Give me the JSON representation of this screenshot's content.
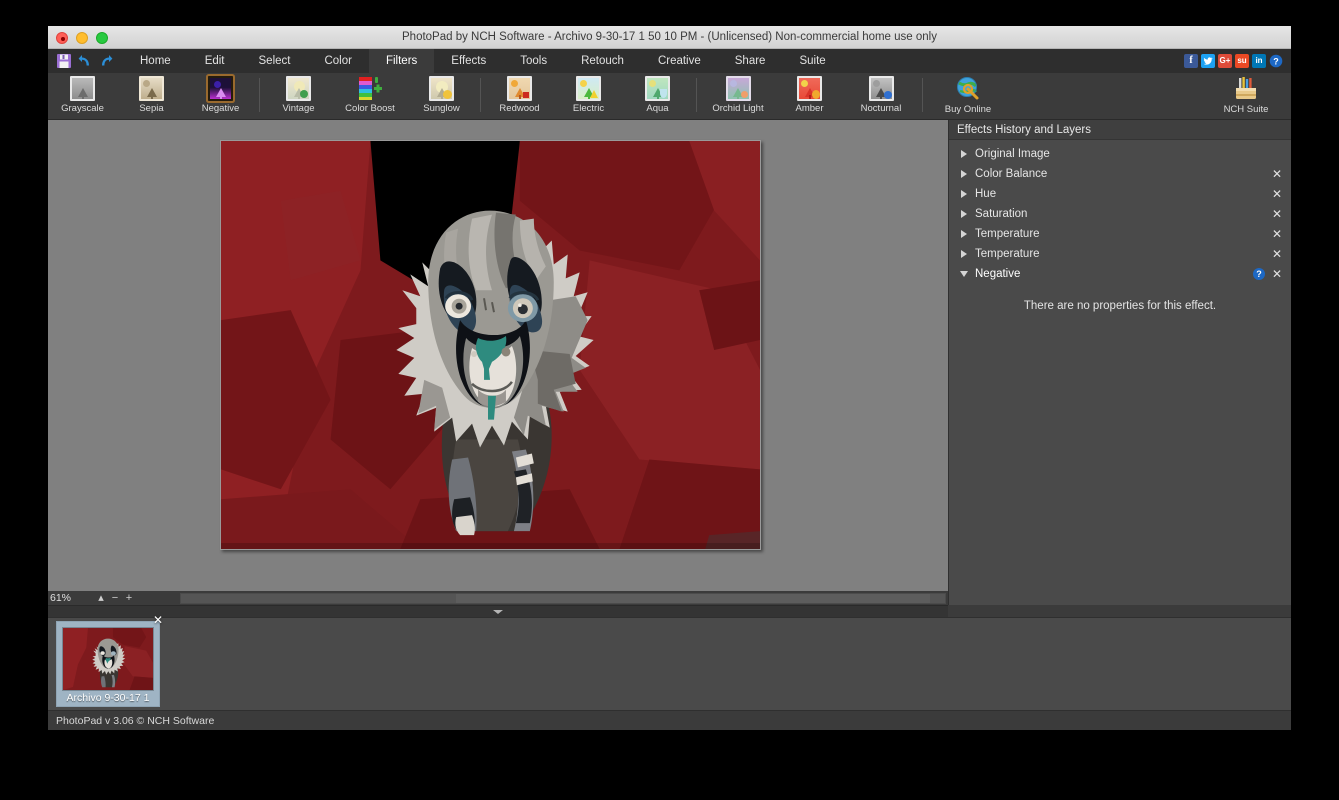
{
  "window": {
    "title": "PhotoPad by NCH Software - Archivo 9-30-17 1 50 10 PM - (Unlicensed) Non-commercial home use only",
    "controls": {
      "close": "close-button",
      "minimize": "minimize-button",
      "maximize": "maximize-button"
    }
  },
  "quick_actions": [
    {
      "name": "save-icon",
      "label": "Save"
    },
    {
      "name": "undo-icon",
      "label": "Undo"
    },
    {
      "name": "redo-icon",
      "label": "Redo"
    }
  ],
  "menu": {
    "tabs": [
      {
        "label": "Home",
        "active": false
      },
      {
        "label": "Edit",
        "active": false
      },
      {
        "label": "Select",
        "active": false
      },
      {
        "label": "Color",
        "active": false
      },
      {
        "label": "Filters",
        "active": true
      },
      {
        "label": "Effects",
        "active": false
      },
      {
        "label": "Tools",
        "active": false
      },
      {
        "label": "Retouch",
        "active": false
      },
      {
        "label": "Creative",
        "active": false
      },
      {
        "label": "Share",
        "active": false
      },
      {
        "label": "Suite",
        "active": false
      }
    ],
    "social": [
      {
        "name": "facebook-icon",
        "glyph": "f"
      },
      {
        "name": "twitter-icon",
        "glyph": "t"
      },
      {
        "name": "googleplus-icon",
        "glyph": "G+"
      },
      {
        "name": "stumbleupon-icon",
        "glyph": "su"
      },
      {
        "name": "linkedin-icon",
        "glyph": "in"
      },
      {
        "name": "help-icon",
        "glyph": "?"
      }
    ]
  },
  "ribbon": {
    "items": [
      {
        "label": "Grayscale",
        "icon": "grayscale-filter-icon",
        "selected": false
      },
      {
        "label": "Sepia",
        "icon": "sepia-filter-icon",
        "selected": false
      },
      {
        "label": "Negative",
        "icon": "negative-filter-icon",
        "selected": true
      },
      {
        "label": "Vintage",
        "icon": "vintage-filter-icon",
        "selected": false
      },
      {
        "label": "Color Boost",
        "icon": "color-boost-filter-icon",
        "selected": false
      },
      {
        "label": "Sunglow",
        "icon": "sunglow-filter-icon",
        "selected": false
      },
      {
        "label": "Redwood",
        "icon": "redwood-filter-icon",
        "selected": false
      },
      {
        "label": "Electric",
        "icon": "electric-filter-icon",
        "selected": false
      },
      {
        "label": "Aqua",
        "icon": "aqua-filter-icon",
        "selected": false
      },
      {
        "label": "Orchid Light",
        "icon": "orchid-light-filter-icon",
        "selected": false
      },
      {
        "label": "Amber",
        "icon": "amber-filter-icon",
        "selected": false
      },
      {
        "label": "Nocturnal",
        "icon": "nocturnal-filter-icon",
        "selected": false
      },
      {
        "label": "Buy Online",
        "icon": "buy-online-icon",
        "selected": false
      }
    ],
    "suite": {
      "label": "NCH Suite",
      "icon": "nch-suite-icon"
    }
  },
  "canvas": {
    "zoom_level": "61%",
    "zoom_buttons": {
      "fit": "▴",
      "minus": "−",
      "plus": "+"
    },
    "image_alt": "Stylized posterized photo of a dog on a dark red background",
    "colors": {
      "workspace": "#808080",
      "background_red": "#7e1a1d",
      "fur_light": "#c9c6c1",
      "fur_dark": "#2f3238",
      "nose_teal": "#2e8b7f"
    }
  },
  "right_panel": {
    "title": "Effects History and Layers",
    "layers": [
      {
        "label": "Original Image",
        "expanded": false,
        "closable": false,
        "has_help": false
      },
      {
        "label": "Color Balance",
        "expanded": false,
        "closable": true,
        "has_help": false
      },
      {
        "label": "Hue",
        "expanded": false,
        "closable": true,
        "has_help": false
      },
      {
        "label": "Saturation",
        "expanded": false,
        "closable": true,
        "has_help": false
      },
      {
        "label": "Temperature",
        "expanded": false,
        "closable": true,
        "has_help": false
      },
      {
        "label": "Temperature",
        "expanded": false,
        "closable": true,
        "has_help": false
      },
      {
        "label": "Negative",
        "expanded": true,
        "closable": true,
        "has_help": true
      }
    ],
    "empty_properties_note": "There are no properties for this effect.",
    "close_glyph": "✕",
    "help_glyph": "?"
  },
  "filmstrip": {
    "thumbnails": [
      {
        "label": "Archivo 9-30-17 1",
        "selected": true,
        "close_glyph": "✕"
      }
    ]
  },
  "statusbar": {
    "text": "PhotoPad v 3.06 © NCH Software"
  }
}
